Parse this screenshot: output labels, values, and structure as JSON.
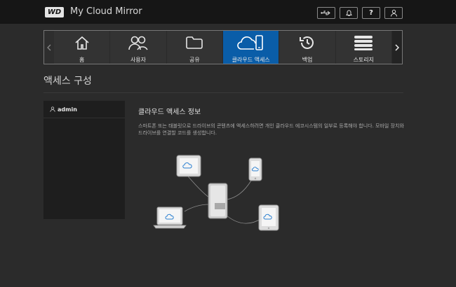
{
  "app": {
    "logo_text": "WD",
    "title": "My Cloud Mirror"
  },
  "top_icons": [
    "usb-icon",
    "bell-icon",
    "help-icon",
    "user-icon"
  ],
  "top_help_glyph": "?",
  "nav": {
    "items": [
      {
        "label": "홈",
        "icon": "home-icon",
        "active": false
      },
      {
        "label": "사용자",
        "icon": "users-icon",
        "active": false
      },
      {
        "label": "공유",
        "icon": "folder-icon",
        "active": false
      },
      {
        "label": "클라우드 액세스",
        "icon": "cloud-device-icon",
        "active": true
      },
      {
        "label": "백업",
        "icon": "history-icon",
        "active": false
      },
      {
        "label": "스토리지",
        "icon": "storage-icon",
        "active": false
      }
    ]
  },
  "page": {
    "title": "액세스 구성"
  },
  "users": [
    {
      "name": "admin"
    }
  ],
  "section": {
    "heading": "클라우드 액세스 정보",
    "description": "스마트폰 또는 태블릿으로 드라이브의 콘텐츠에 액세스하려면 개인 클라우드 에코시스템의 일부로 등록해야 합니다. 모바일 장치와 드라이브를 연결할 코드를 생성합니다."
  },
  "colors": {
    "accent": "#0a5da8",
    "background": "#2b2b2b",
    "topbar": "#161616"
  }
}
